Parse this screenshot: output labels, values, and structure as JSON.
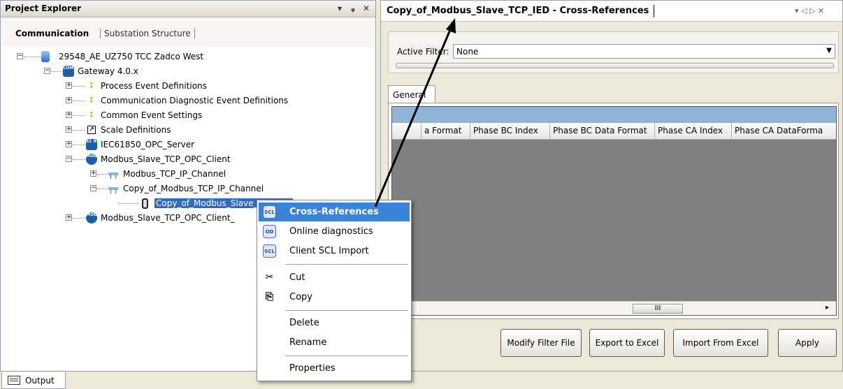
{
  "left_pane": {
    "title": "Project Explorer",
    "controls": {
      "dropdown": "▾",
      "pin": "ᵩ",
      "close": "✕"
    },
    "tabs": {
      "active": "Communication",
      "inactive": "Substation Structure"
    },
    "tree": [
      {
        "label": "29548_AE_UZ750 TCC Zadco West",
        "expander": "−",
        "icon": "database"
      },
      {
        "label": "Gateway 4.0.x",
        "expander": "−",
        "icon": "com600",
        "icon_text": "COM 600"
      },
      {
        "label": "Process Event Definitions",
        "expander": "+",
        "icon": "event"
      },
      {
        "label": "Communication Diagnostic Event Definitions",
        "expander": "+",
        "icon": "event"
      },
      {
        "label": "Common Event Settings",
        "expander": "+",
        "icon": "event"
      },
      {
        "label": "Scale Definitions",
        "expander": "+",
        "icon": "scale"
      },
      {
        "label": "IEC61850_OPC_Server",
        "expander": "+",
        "icon": "iec",
        "icon_text": "61 850"
      },
      {
        "label": "Modbus_Slave_TCP_OPC_Client",
        "expander": "−",
        "icon": "modbus",
        "icon_text": "MOD BUS"
      },
      {
        "label": "Modbus_TCP_IP_Channel",
        "expander": "+",
        "icon": "channel"
      },
      {
        "label": "Copy_of_Modbus_TCP_IP_Channel",
        "expander": "−",
        "icon": "channel"
      },
      {
        "label": "Copy_of_Modbus_Slave_TCP_IED",
        "expander": "",
        "icon": "ied"
      },
      {
        "label": "Modbus_Slave_TCP_OPC_Client_",
        "expander": "+",
        "icon": "modbus",
        "icon_text": "MOD BUS"
      }
    ]
  },
  "right_pane": {
    "title": "Copy_of_Modbus_Slave_TCP_IED - Cross-References",
    "controls": "▾ ◁ ▷ ✕",
    "filter": {
      "label": "Active Filter:",
      "value": "None"
    },
    "tab": "General",
    "grid_columns": [
      "a Format",
      "Phase BC Index",
      "Phase BC Data Format",
      "Phase CA Index",
      "Phase CA DataForma"
    ],
    "scroll_thumb": "III",
    "buttons": {
      "modify": "Modify Filter File",
      "export": "Export to Excel",
      "import": "Import From Excel",
      "apply": "Apply"
    }
  },
  "context_menu": {
    "items": [
      {
        "label": "Cross-References",
        "icon": "SCL",
        "highlighted": true
      },
      {
        "label": "Online diagnostics",
        "icon": "OD"
      },
      {
        "label": "Client SCL Import",
        "icon": "SCL"
      },
      {
        "label": "Cut",
        "icon": "scissors"
      },
      {
        "label": "Copy",
        "icon": "copy"
      },
      {
        "label": "Delete"
      },
      {
        "label": "Rename"
      },
      {
        "label": "Properties"
      }
    ]
  },
  "bottom": {
    "output_tab": "Output"
  },
  "colors": {
    "highlight": "#3b83d9",
    "selection": "#316ac5",
    "grid_band": "#8fb4d8"
  }
}
